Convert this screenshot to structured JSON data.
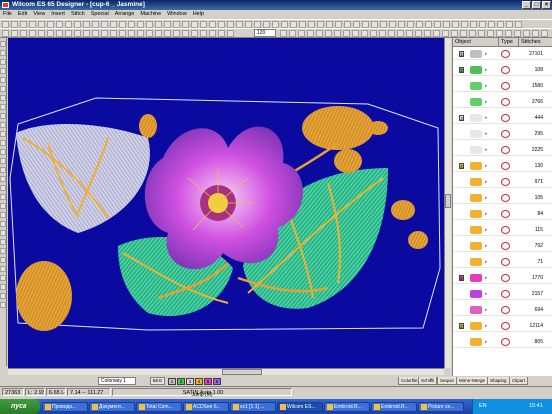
{
  "window": {
    "title": "Wilcom ES 65 Designer - [cup-6 _ Jasmine]",
    "controls": [
      "_",
      "□",
      "×"
    ]
  },
  "menu": [
    "File",
    "Edit",
    "View",
    "Insert",
    "Stitch",
    "Special",
    "Arrange",
    "Machine",
    "Window",
    "Help"
  ],
  "toolbar": {
    "zoom_value": "120"
  },
  "object_panel": {
    "headers": {
      "obj": "Object",
      "type": "Type",
      "stitches": "Stitches"
    },
    "rows": [
      {
        "group": "1",
        "color": "#c0c0c0",
        "stitches": "27101"
      },
      {
        "group": "2",
        "color": "#50c050",
        "stitches": "108"
      },
      {
        "group": "",
        "color": "#60d060",
        "stitches": "1580"
      },
      {
        "group": "",
        "color": "#60d060",
        "stitches": "2766"
      },
      {
        "group": "3",
        "color": "#e8e8e8",
        "stitches": "444"
      },
      {
        "group": "",
        "color": "#e8e8e8",
        "stitches": "295"
      },
      {
        "group": "",
        "color": "#e8e8e8",
        "stitches": "2225"
      },
      {
        "group": "4",
        "color": "#f0b030",
        "stitches": "130"
      },
      {
        "group": "",
        "color": "#f0b030",
        "stitches": "971"
      },
      {
        "group": "",
        "color": "#f0b030",
        "stitches": "105"
      },
      {
        "group": "",
        "color": "#f0b030",
        "stitches": "84"
      },
      {
        "group": "",
        "color": "#f0b030",
        "stitches": "115"
      },
      {
        "group": "",
        "color": "#f0b030",
        "stitches": "792"
      },
      {
        "group": "",
        "color": "#f0b030",
        "stitches": "71"
      },
      {
        "group": "5",
        "color": "#e040c0",
        "stitches": "1770"
      },
      {
        "group": "",
        "color": "#c040e0",
        "stitches": "2157"
      },
      {
        "group": "",
        "color": "#e060c0",
        "stitches": "694"
      },
      {
        "group": "2",
        "color": "#f0b030",
        "stitches": "12114"
      },
      {
        "group": "",
        "color": "#f0b030",
        "stitches": "805"
      }
    ]
  },
  "tabs": [
    "Colorfile",
    "Schiffli",
    "Sequin",
    "Mirror-Merge",
    "Shaping",
    "Clipart"
  ],
  "colorbar": {
    "colorway": "Colorway 1",
    "bkg": "BKG",
    "swatches": [
      {
        "n": "1",
        "c": "#c0c0c0"
      },
      {
        "n": "2",
        "c": "#50c050"
      },
      {
        "n": "3",
        "c": "#d8d8d8"
      },
      {
        "n": "4",
        "c": "#f0b030"
      },
      {
        "n": "5",
        "c": "#e040c0"
      },
      {
        "n": "6",
        "c": "#a060e0"
      }
    ]
  },
  "status": {
    "count": "27363",
    "coords": "L: 2.93\"",
    "xy": "6.65 L+",
    "dims": "7.14 -- 111.27",
    "mode": "SATIN Auto 1.00",
    "jump": "Jump (M)"
  },
  "taskbar": {
    "start": "пуск",
    "tasks": [
      "Проводн...",
      "Документ...",
      "Total Com...",
      "ACDSee 6...",
      "sx1 [1:1] ...",
      "Wilcom ES...",
      "Embroid.R...",
      "Embroid.R...",
      "Picture се..."
    ],
    "tray_lang": "EN",
    "time": "15:41"
  },
  "palette": {
    "canvas_bg": "#0a0aa0",
    "leaf_green": "#2fc08a",
    "petal_pink": "#e040c0",
    "gold": "#f0b030"
  }
}
